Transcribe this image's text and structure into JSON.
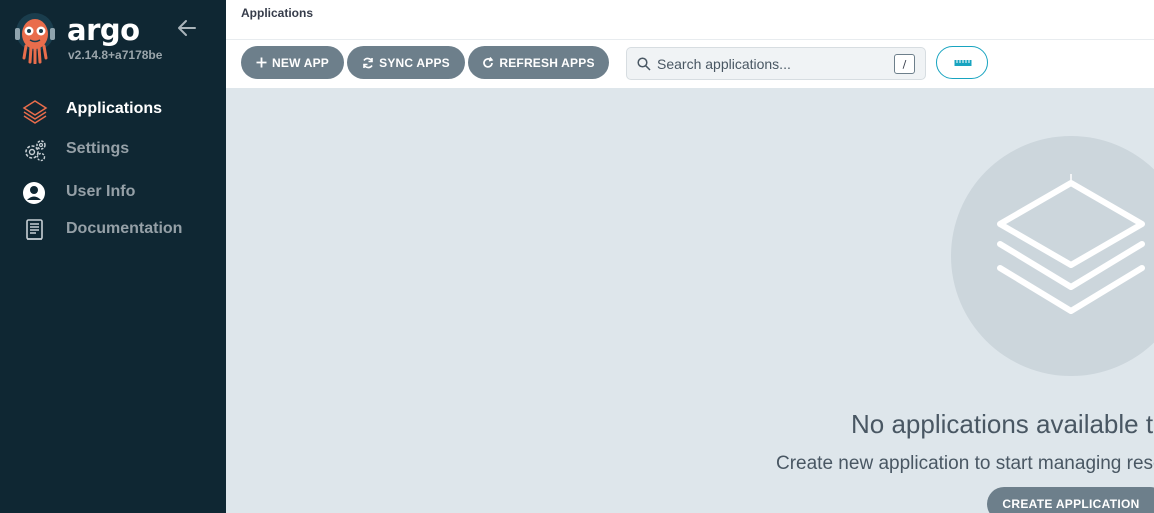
{
  "app": {
    "brand": "argo",
    "version": "v2.14.8+a7178be"
  },
  "sidebar": {
    "items": [
      {
        "label": "Applications",
        "icon": "layers-icon",
        "active": true
      },
      {
        "label": "Settings",
        "icon": "gears-icon",
        "active": false
      },
      {
        "label": "User Info",
        "icon": "user-circle-icon",
        "active": false
      },
      {
        "label": "Documentation",
        "icon": "book-icon",
        "active": false
      }
    ]
  },
  "header": {
    "title": "Applications"
  },
  "toolbar": {
    "new_app": "NEW APP",
    "sync_apps": "SYNC APPS",
    "refresh_apps": "REFRESH APPS",
    "search_placeholder": "Search applications...",
    "search_shortcut": "/"
  },
  "empty_state": {
    "title": "No applications available to manage",
    "subtitle": "Create new application to start managing resources in your cluster",
    "cta": "CREATE APPLICATION"
  },
  "colors": {
    "sidebar_bg": "#0f2733",
    "button_bg": "#6d7f8b",
    "accent": "#18a4c0",
    "brand_orange": "#e96d4c",
    "content_bg": "#dee6eb"
  }
}
